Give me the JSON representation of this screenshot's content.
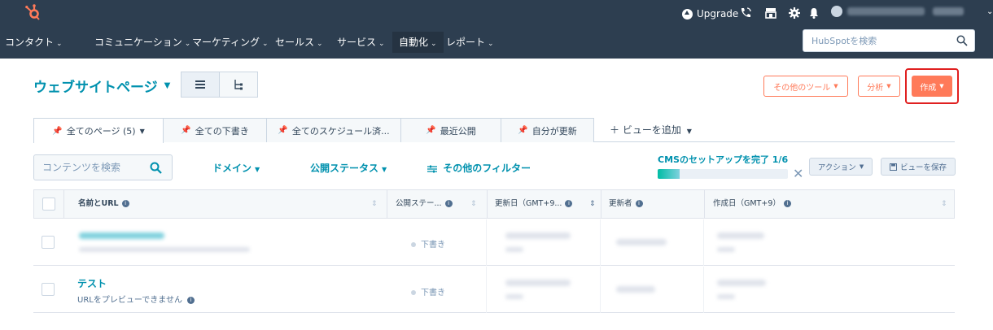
{
  "topnav": {
    "upgrade_label": "Upgrade",
    "menu": [
      {
        "label": "コンタクト"
      },
      {
        "label": "コミュニケーション"
      },
      {
        "label": "マーケティング"
      },
      {
        "label": "セールス"
      },
      {
        "label": "サービス"
      },
      {
        "label": "自動化"
      },
      {
        "label": "レポート"
      }
    ],
    "search_placeholder": "HubSpotを検索"
  },
  "header": {
    "title": "ウェブサイトページ",
    "other_tools": "その他のツール",
    "analyze": "分析",
    "create": "作成"
  },
  "tabs": [
    {
      "label": "全てのページ (5)"
    },
    {
      "label": "全ての下書き"
    },
    {
      "label": "全てのスケジュール済..."
    },
    {
      "label": "最近公開"
    },
    {
      "label": "自分が更新"
    }
  ],
  "add_view": "ビューを追加",
  "filters": {
    "search_placeholder": "コンテンツを検索",
    "domain": "ドメイン",
    "publish_status": "公開ステータス",
    "more_filters": "その他のフィルター",
    "cms_setup": "CMSのセットアップを完了 1/6",
    "cms_progress": 0.17,
    "actions": "アクション",
    "save_view": "ビューを保存"
  },
  "table": {
    "columns": [
      "名前とURL",
      "公開ステー...",
      "更新日（GMT+9...",
      "更新者",
      "作成日（GMT+9）"
    ],
    "rows": [
      {
        "title": "",
        "subtitle": "",
        "status": "下書き"
      },
      {
        "title": "テスト",
        "subtitle": "URLをプレビューできません",
        "status": "下書き"
      }
    ]
  },
  "colors": {
    "nav_bg": "#2d3e50",
    "accent": "#0091ae",
    "brand_orange": "#ff7a59",
    "highlight_red": "#e02020"
  }
}
